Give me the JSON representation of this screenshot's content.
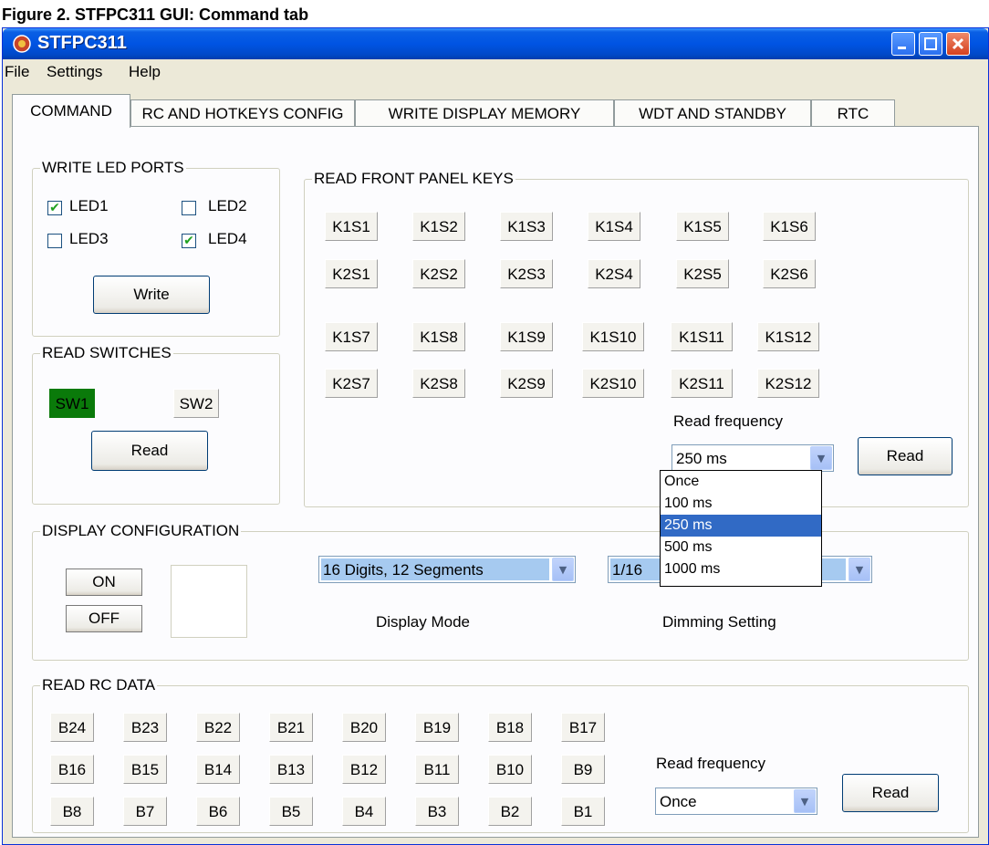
{
  "caption": "Figure 2. STFPC311 GUI: Command tab",
  "window": {
    "title": "STFPC311"
  },
  "menu": [
    "File",
    "Settings",
    "Help"
  ],
  "tabs": [
    "COMMAND",
    "RC AND HOTKEYS CONFIG",
    "WRITE DISPLAY MEMORY",
    "WDT AND STANDBY",
    "RTC"
  ],
  "led_ports": {
    "title": "WRITE LED PORTS",
    "leds": [
      {
        "label": "LED1",
        "checked": true
      },
      {
        "label": "LED2",
        "checked": false
      },
      {
        "label": "LED3",
        "checked": false
      },
      {
        "label": "LED4",
        "checked": true
      }
    ],
    "write_label": "Write"
  },
  "switches": {
    "title": "READ SWITCHES",
    "sw1": "SW1",
    "sw1_color": "#0a7a0a",
    "sw2": "SW2",
    "read_label": "Read"
  },
  "front_panel": {
    "title": "READ FRONT PANEL KEYS",
    "rows": [
      [
        "K1S1",
        "K1S2",
        "K1S3",
        "K1S4",
        "K1S5",
        "K1S6"
      ],
      [
        "K2S1",
        "K2S2",
        "K2S3",
        "K2S4",
        "K2S5",
        "K2S6"
      ],
      [
        "K1S7",
        "K1S8",
        "K1S9",
        "K1S10",
        "K1S11",
        "K1S12"
      ],
      [
        "K2S7",
        "K2S8",
        "K2S9",
        "K2S10",
        "K2S11",
        "K2S12"
      ]
    ],
    "freq_label": "Read frequency",
    "freq_value": "250 ms",
    "freq_options": [
      "Once",
      "100 ms",
      "250 ms",
      "500 ms",
      "1000 ms"
    ],
    "read_label": "Read"
  },
  "display_config": {
    "title": "DISPLAY CONFIGURATION",
    "on_label": "ON",
    "off_label": "OFF",
    "mode_value": "16 Digits, 12 Segments",
    "mode_label": "Display Mode",
    "dimming_value": "1/16",
    "dimming_label": "Dimming Setting"
  },
  "rc_data": {
    "title": "READ RC DATA",
    "rows": [
      [
        "B24",
        "B23",
        "B22",
        "B21",
        "B20",
        "B19",
        "B18",
        "B17"
      ],
      [
        "B16",
        "B15",
        "B14",
        "B13",
        "B12",
        "B11",
        "B10",
        "B9"
      ],
      [
        "B8",
        "B7",
        "B6",
        "B5",
        "B4",
        "B3",
        "B2",
        "B1"
      ]
    ],
    "freq_label": "Read frequency",
    "freq_value": "Once",
    "read_label": "Read"
  }
}
